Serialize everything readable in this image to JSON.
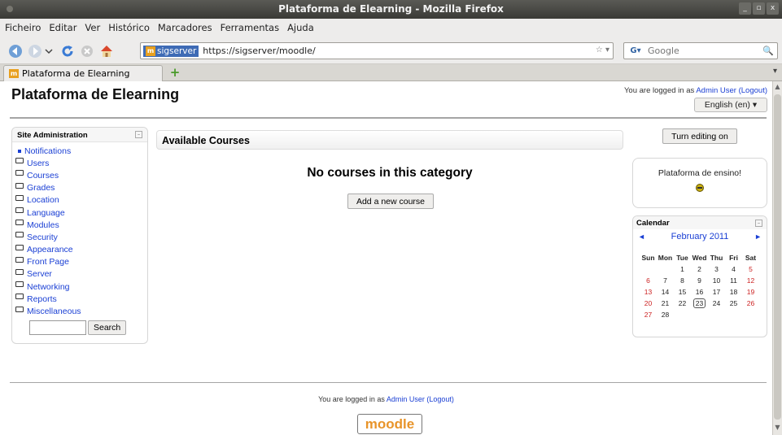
{
  "window": {
    "title": "Plataforma de Elearning - Mozilla Firefox",
    "buttons": [
      "_",
      "▫",
      "x"
    ]
  },
  "menu": [
    "Ficheiro",
    "Editar",
    "Ver",
    "Histórico",
    "Marcadores",
    "Ferramentas",
    "Ajuda"
  ],
  "toolbar": {
    "site_identity": "sigserver",
    "url": "https://sigserver/moodle/",
    "search_placeholder": "Google",
    "search_engine": "google-icon"
  },
  "tabs": [
    {
      "label": "Plataforma de Elearning",
      "active": true
    }
  ],
  "page": {
    "site_title": "Plataforma de Elearning",
    "login_prefix": "You are logged in as ",
    "user": "Admin User",
    "logout": "(Logout)",
    "language": "English (en)"
  },
  "admin_block": {
    "title": "Site Administration",
    "items": [
      {
        "label": "Notifications",
        "icon": "bullet-icon"
      },
      {
        "label": "Users",
        "icon": "folder-icon"
      },
      {
        "label": "Courses",
        "icon": "folder-icon"
      },
      {
        "label": "Grades",
        "icon": "folder-icon"
      },
      {
        "label": "Location",
        "icon": "folder-icon"
      },
      {
        "label": "Language",
        "icon": "folder-icon"
      },
      {
        "label": "Modules",
        "icon": "folder-icon"
      },
      {
        "label": "Security",
        "icon": "folder-icon"
      },
      {
        "label": "Appearance",
        "icon": "folder-icon"
      },
      {
        "label": "Front Page",
        "icon": "folder-icon"
      },
      {
        "label": "Server",
        "icon": "folder-icon"
      },
      {
        "label": "Networking",
        "icon": "folder-icon"
      },
      {
        "label": "Reports",
        "icon": "folder-icon"
      },
      {
        "label": "Miscellaneous",
        "icon": "folder-icon"
      }
    ],
    "search_button": "Search"
  },
  "courses": {
    "header": "Available Courses",
    "empty_message": "No courses in this category",
    "add_button": "Add a new course"
  },
  "right_column": {
    "turn_editing_button": "Turn editing on",
    "ensino_text": "Plataforma de ensino!"
  },
  "calendar": {
    "title": "Calendar",
    "month": "February 2011",
    "weekdays": [
      "Sun",
      "Mon",
      "Tue",
      "Wed",
      "Thu",
      "Fri",
      "Sat"
    ],
    "weeks": [
      [
        "",
        "",
        "1",
        "2",
        "3",
        "4",
        "5"
      ],
      [
        "6",
        "7",
        "8",
        "9",
        "10",
        "11",
        "12"
      ],
      [
        "13",
        "14",
        "15",
        "16",
        "17",
        "18",
        "19"
      ],
      [
        "20",
        "21",
        "22",
        "23",
        "24",
        "25",
        "26"
      ],
      [
        "27",
        "28",
        "",
        "",
        "",
        "",
        ""
      ]
    ],
    "today": "23"
  },
  "footer": {
    "login_prefix": "You are logged in as ",
    "user": "Admin User",
    "logout": "(Logout)",
    "logo_text": "moodle"
  },
  "colors": {
    "link": "#1a3fd4",
    "weekend": "#cc2222",
    "titlebar": "#3a3a36",
    "logo": "#e8942a"
  }
}
